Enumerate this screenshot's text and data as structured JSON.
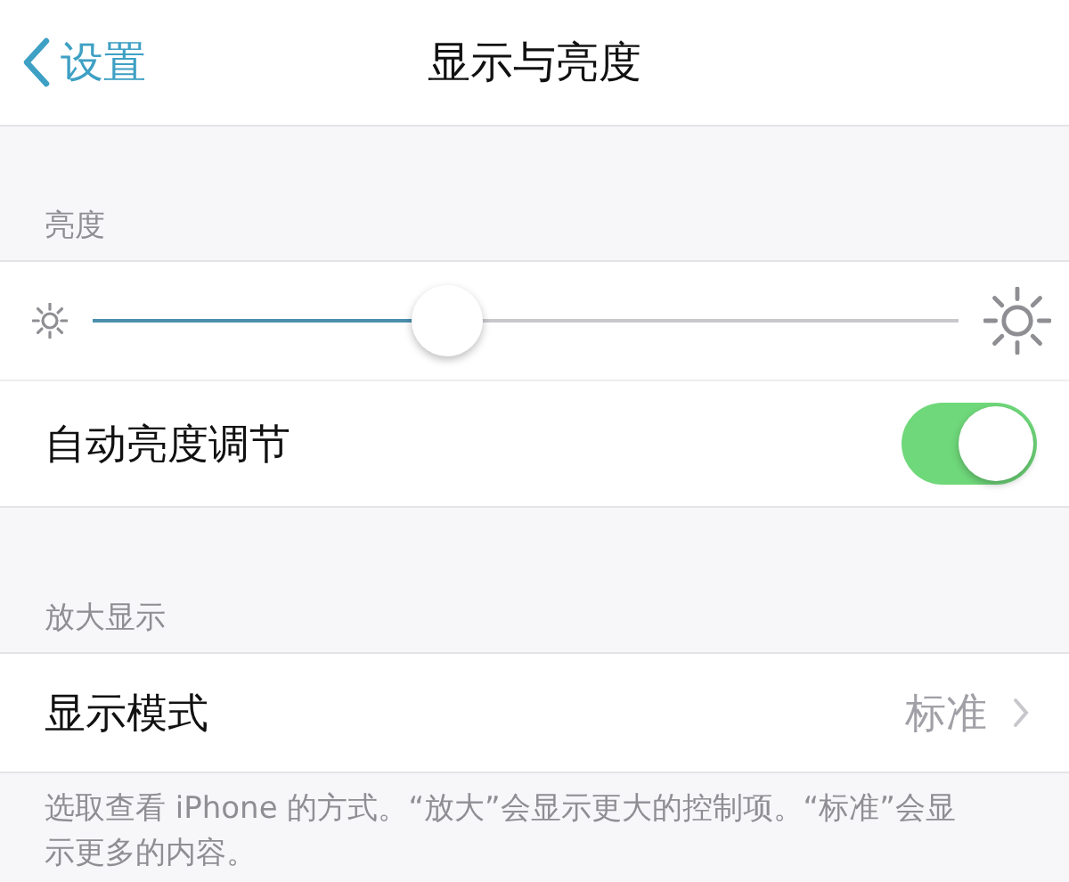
{
  "nav": {
    "back": "设置",
    "title": "显示与亮度"
  },
  "brightness": {
    "header": "亮度",
    "level": 0.41
  },
  "auto_brightness": {
    "label": "自动亮度调节",
    "on": true
  },
  "zoom_section": {
    "header": "放大显示",
    "rows": [
      {
        "label": "显示模式",
        "value": "标准"
      }
    ],
    "footer": "选取查看 iPhone 的方式。“放大”会显示更大的控制项。“标准”会显示更多的内容。"
  }
}
